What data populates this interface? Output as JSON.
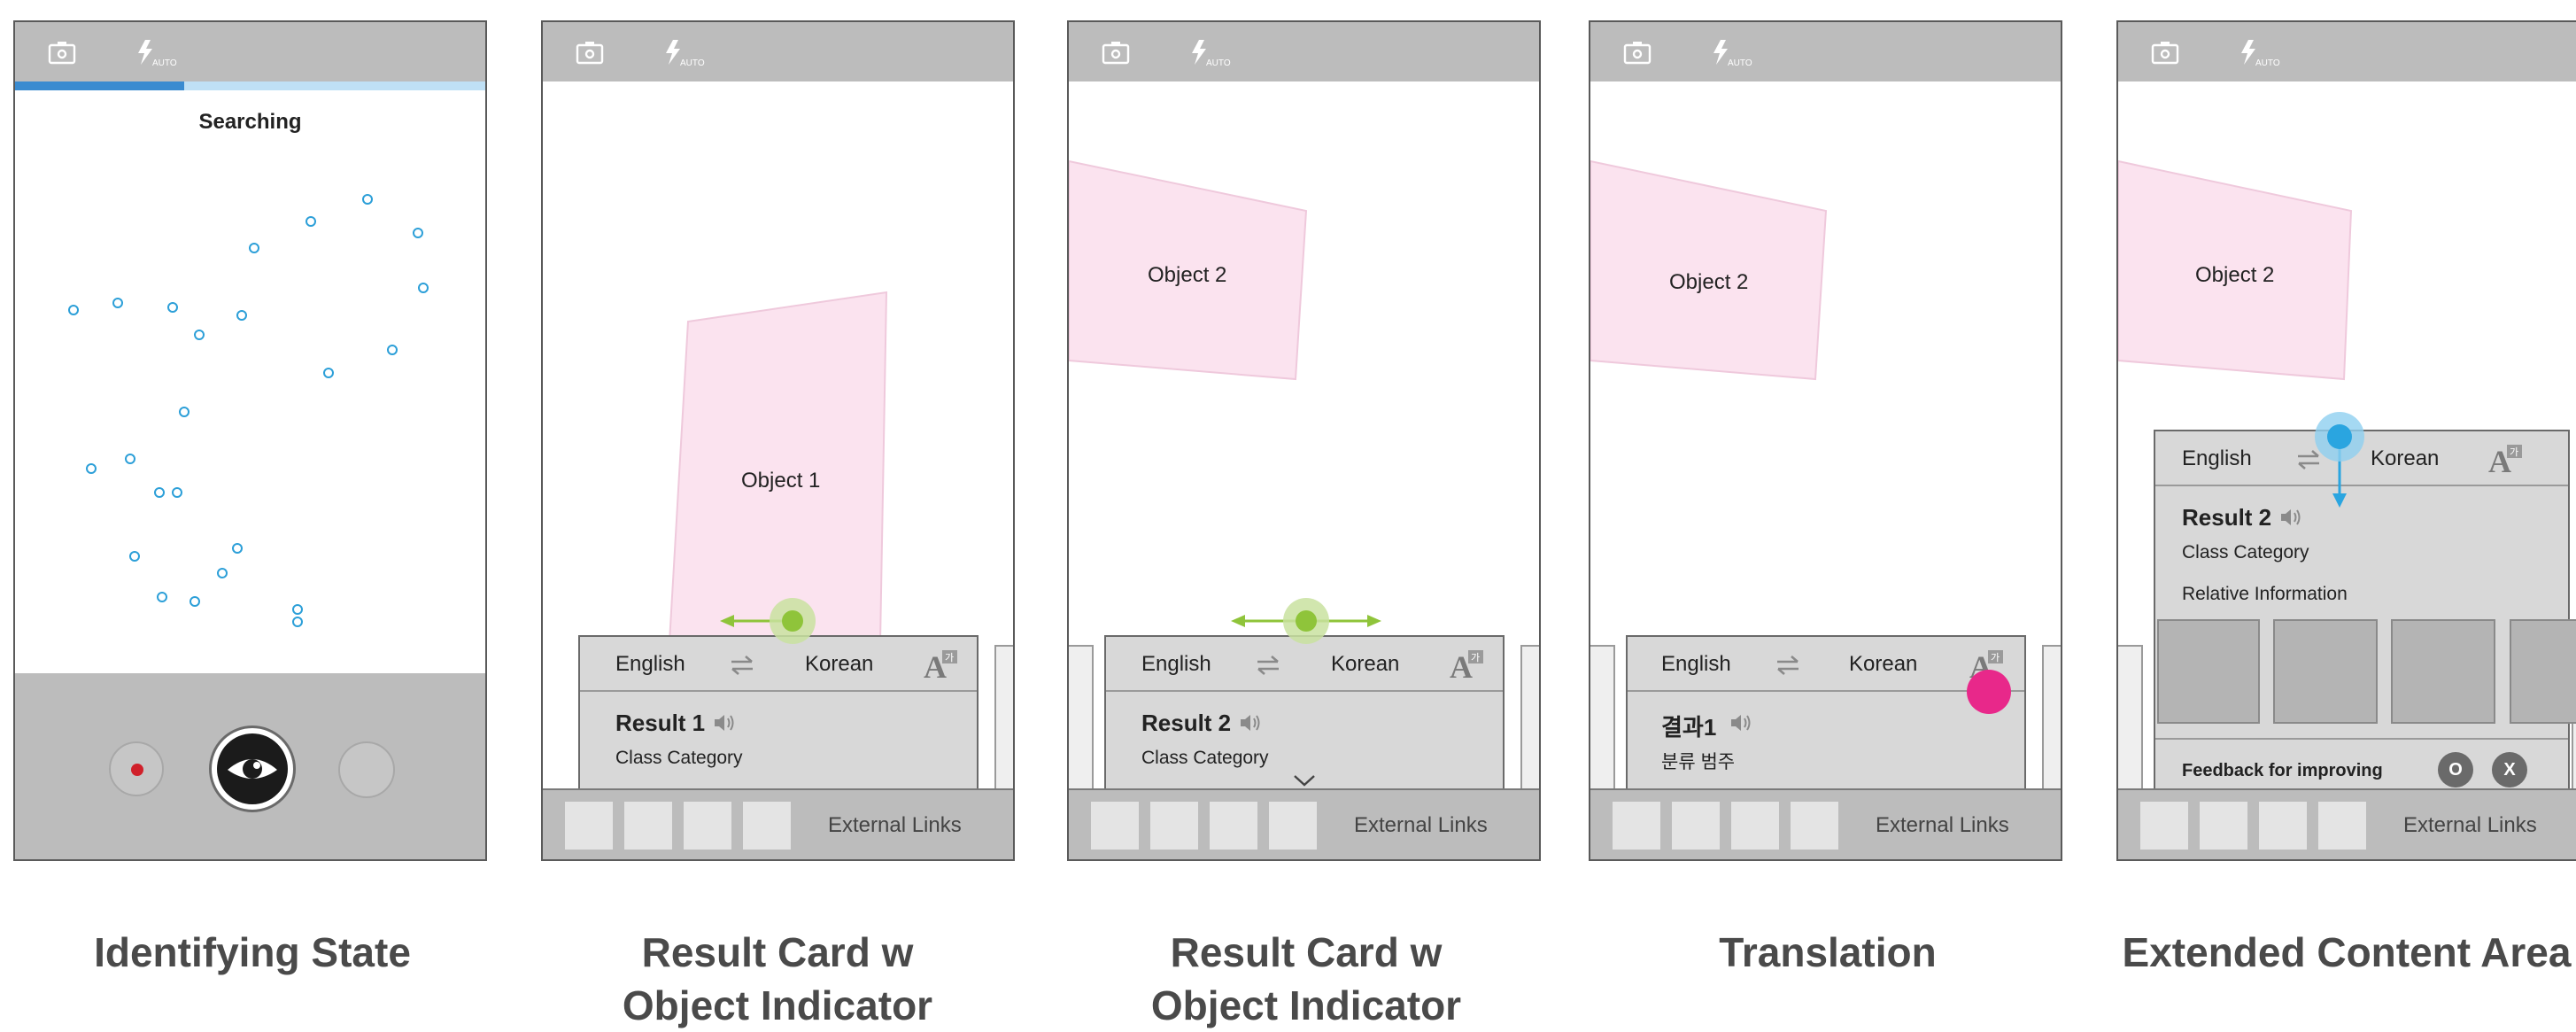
{
  "panels": [
    {
      "caption_line1": "Identifying State",
      "caption_line2": "",
      "status": "Searching",
      "progress": 0.36
    },
    {
      "caption_line1": "Result Card w",
      "caption_line2": "Object Indicator",
      "object_label": "Object 1",
      "source_language": "English",
      "target_language": "Korean",
      "result_title": "Result 1",
      "result_class": "Class Category",
      "external_links": "External Links"
    },
    {
      "caption_line1": "Result Card w",
      "caption_line2": "Object Indicator",
      "object_label": "Object 2",
      "source_language": "English",
      "target_language": "Korean",
      "result_title": "Result 2",
      "result_class": "Class Category",
      "external_links": "External Links"
    },
    {
      "caption_line1": "Translation",
      "caption_line2": "",
      "object_label": "Object 2",
      "source_language": "English",
      "target_language": "Korean",
      "result_title": "결과1",
      "result_class": "분류 범주",
      "external_links": "External Links"
    },
    {
      "caption_line1": "Extended Content Area",
      "caption_line2": "",
      "object_label": "Object 2",
      "source_language": "English",
      "target_language": "Korean",
      "result_title": "Result 2",
      "result_class": "Class Category",
      "relative_info": "Relative Information",
      "feedback_text": "Feedback for improving",
      "feedback_yes": "O",
      "feedback_no": "X",
      "external_links": "External Links"
    }
  ],
  "topbar_icons": [
    "camera-switch-icon",
    "flash-auto-icon"
  ],
  "flash_mode_label": "AUTO",
  "colors": {
    "progress_fill": "#3a8bd0",
    "progress_track": "#bfe0f5",
    "object_fill": "#fbe3ef",
    "indicator_green": "#8fc43a",
    "indicator_blue": "#2aa5e0",
    "translation_pink": "#e8288a",
    "feature_dot": "#2c9fd8"
  }
}
